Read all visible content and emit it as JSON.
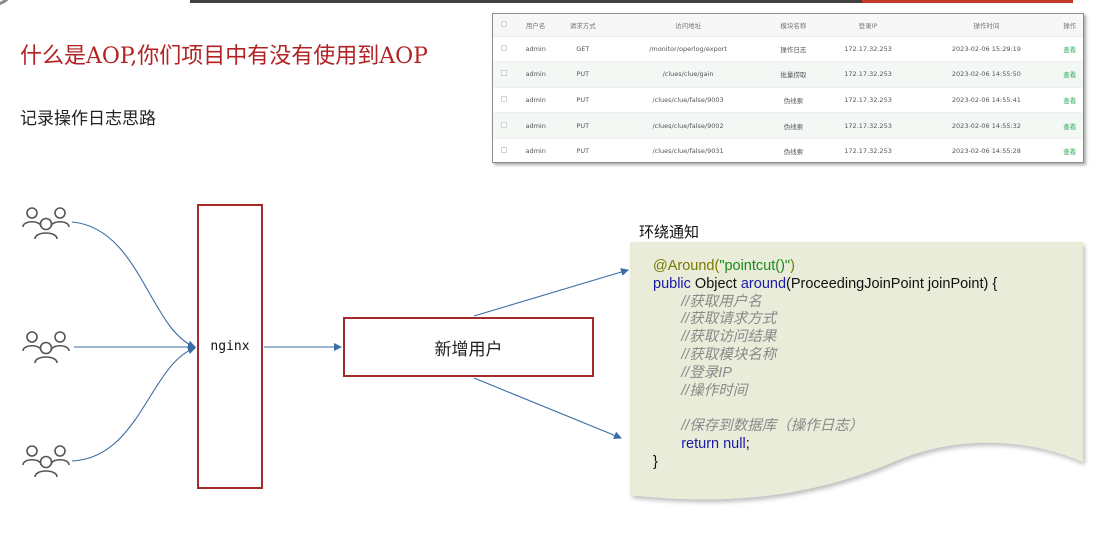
{
  "title": "什么是AOP,你们项目中有没有使用到AOP",
  "subtitle": "记录操作日志思路",
  "log_table": {
    "headers": [
      "",
      "用户名",
      "请求方式",
      "访问地址",
      "模块名称",
      "登录IP",
      "操作时间",
      "操作"
    ],
    "rows": [
      {
        "user": "admin",
        "method": "GET",
        "url": "/monitor/operlog/export",
        "module": "操作日志",
        "ip": "172.17.32.253",
        "time": "2023-02-06 15:29:19",
        "action": "查看"
      },
      {
        "user": "admin",
        "method": "PUT",
        "url": "/clues/clue/gain",
        "module": "批量捞取",
        "ip": "172.17.32.253",
        "time": "2023-02-06 14:55:50",
        "action": "查看"
      },
      {
        "user": "admin",
        "method": "PUT",
        "url": "/clues/clue/false/9003",
        "module": "伪线索",
        "ip": "172.17.32.253",
        "time": "2023-02-06 14:55:41",
        "action": "查看"
      },
      {
        "user": "admin",
        "method": "PUT",
        "url": "/clues/clue/false/9002",
        "module": "伪线索",
        "ip": "172.17.32.253",
        "time": "2023-02-06 14:55:32",
        "action": "查看"
      },
      {
        "user": "admin",
        "method": "PUT",
        "url": "/clues/clue/false/9031",
        "module": "伪线索",
        "ip": "172.17.32.253",
        "time": "2023-02-06 14:55:28",
        "action": "查看"
      }
    ]
  },
  "diagram": {
    "nginx_label": "nginx",
    "add_user_label": "新增用户",
    "advice_label": "环绕通知",
    "user_icons": [
      "users-icon",
      "users-icon",
      "users-icon"
    ]
  },
  "code": {
    "line1_anno": "@Around(",
    "line1_str": "\"pointcut()\"",
    "line1_end": ")",
    "line2_kw": "public",
    "line2_type": " Object ",
    "line2_fn": "around",
    "line2_rest": "(ProceedingJoinPoint joinPoint) {",
    "comments": [
      "//获取用户名",
      "//获取请求方式",
      "//获取访问结果",
      "//获取模块名称",
      "//登录IP",
      "//操作时间"
    ],
    "save_comment": "//保存到数据库（操作日志）",
    "return_kw": "return",
    "return_val": " null",
    "return_end": ";",
    "closing": "}"
  },
  "colors": {
    "title": "#b22222",
    "box_border": "#a52a2a",
    "arrow": "#3a6ea5",
    "note_fill": "#e8ecd9",
    "view_link": "#2eaa5c"
  }
}
